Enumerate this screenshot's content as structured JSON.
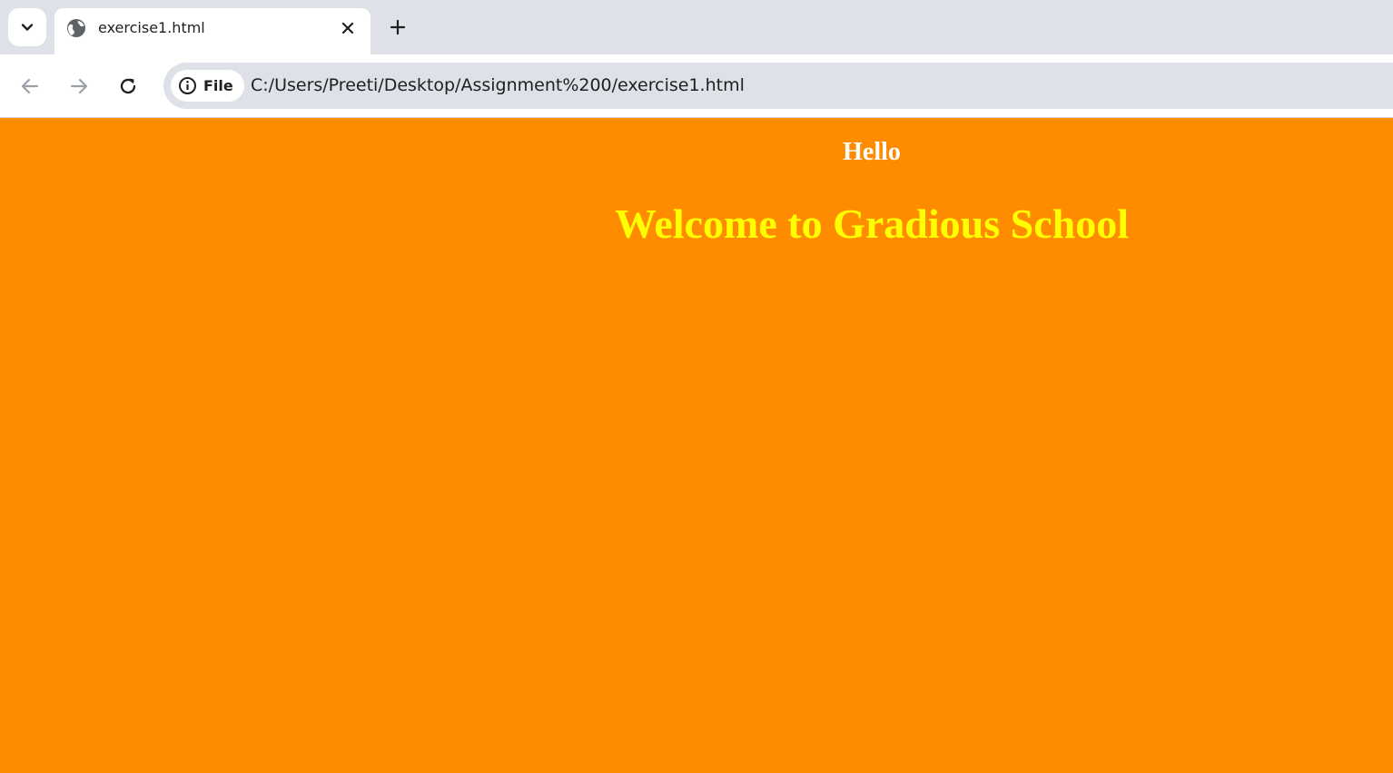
{
  "browser": {
    "tab": {
      "title": "exercise1.html",
      "favicon": "globe-icon"
    },
    "icons": {
      "tab_search": "chevron-down-icon",
      "tab_close": "close-icon",
      "new_tab": "plus-icon",
      "back": "arrow-left-icon",
      "forward": "arrow-right-icon",
      "reload": "reload-icon",
      "site_info": "info-icon"
    },
    "omnibox": {
      "chip_label": "File",
      "url": "C:/Users/Preeti/Desktop/Assignment%200/exercise1.html"
    }
  },
  "page": {
    "heading_small": "Hello",
    "heading_large": "Welcome to Gradious School"
  },
  "colors": {
    "page_background": "#ff8c00",
    "hello_text": "#ffffff",
    "welcome_text": "#ffff00",
    "tabstrip": "#dee1e8"
  }
}
